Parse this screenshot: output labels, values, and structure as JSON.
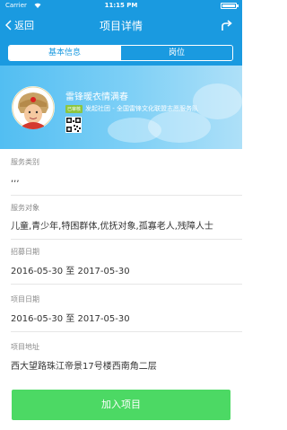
{
  "status_bar": {
    "carrier": "Carrier",
    "time": "11:15 PM",
    "battery_level": 1.0
  },
  "nav": {
    "back_label": "返回",
    "title": "项目详情"
  },
  "tabs": [
    {
      "label": "基本信息",
      "active": true
    },
    {
      "label": "岗位",
      "active": false
    }
  ],
  "project": {
    "title": "雷锋暖衣情满春",
    "org_badge": "已审核",
    "org_text": "发起社团 - 全国雷锋文化联盟志愿服务队"
  },
  "fields": [
    {
      "label": "服务类别",
      "value": ",,,"
    },
    {
      "label": "服务对象",
      "value": "儿童,青少年,特困群体,优抚对象,孤寡老人,残障人士"
    },
    {
      "label": "招募日期",
      "value": "2016-05-30 至 2017-05-30"
    },
    {
      "label": "项目日期",
      "value": "2016-05-30 至 2017-05-30"
    },
    {
      "label": "项目地址",
      "value": "西大望路珠江帝景17号楼西南角二层"
    }
  ],
  "join_button": {
    "label": "加入项目"
  },
  "colors": {
    "primary": "#1a9ae0",
    "button": "#4cd964"
  }
}
